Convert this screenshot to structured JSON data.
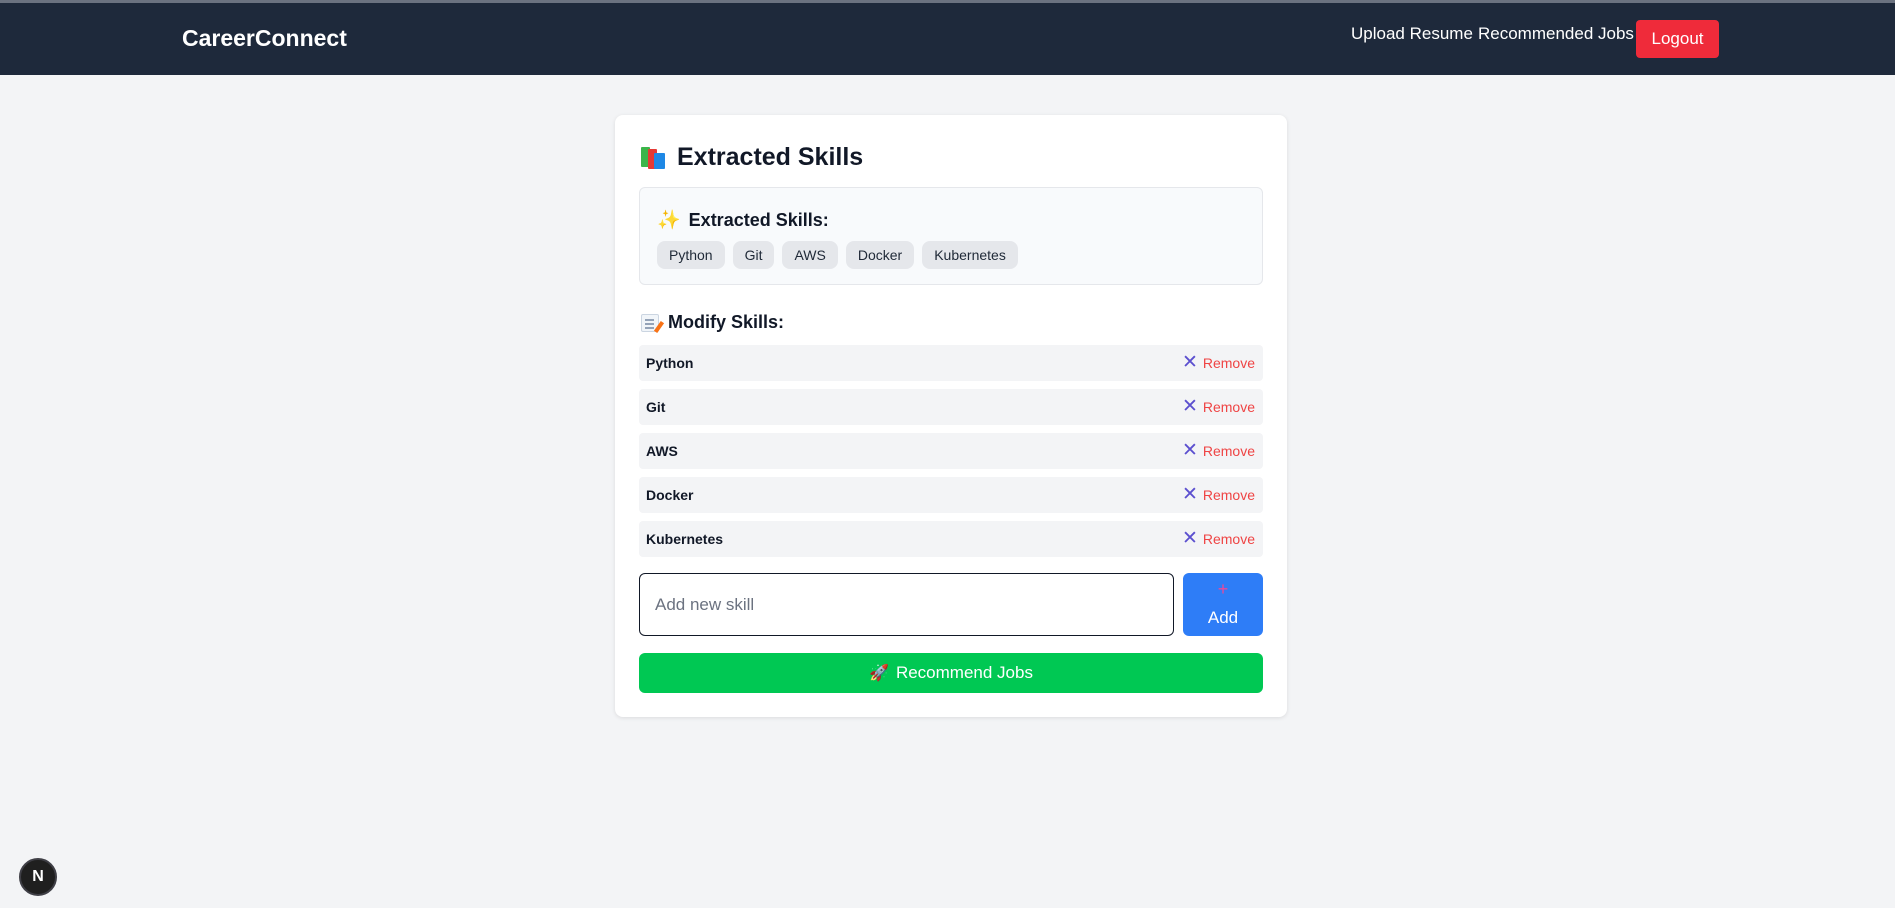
{
  "navbar": {
    "brand": "CareerConnect",
    "links": [
      "Upload Resume",
      "Recommended Jobs"
    ],
    "logout_label": "Logout"
  },
  "card": {
    "title": "Extracted Skills",
    "title_icon": "books-icon",
    "extracted": {
      "heading": "Extracted Skills:",
      "heading_icon": "sparkles-icon",
      "skills": [
        "Python",
        "Git",
        "AWS",
        "Docker",
        "Kubernetes"
      ]
    },
    "modify": {
      "heading": "Modify Skills:",
      "heading_icon": "memo-icon",
      "remove_label": "Remove",
      "skills": [
        "Python",
        "Git",
        "AWS",
        "Docker",
        "Kubernetes"
      ]
    },
    "input": {
      "placeholder": "Add new skill",
      "value": ""
    },
    "add_label": "Add",
    "recommend_label": "Recommend Jobs"
  },
  "dev_badge": "N",
  "colors": {
    "navbar": "#1e293b",
    "logout": "#ef2b3a",
    "add_button": "#2e7df7",
    "recommend_button": "#00c853",
    "remove_text": "#ef4444",
    "remove_icon": "#5b4fcf"
  }
}
